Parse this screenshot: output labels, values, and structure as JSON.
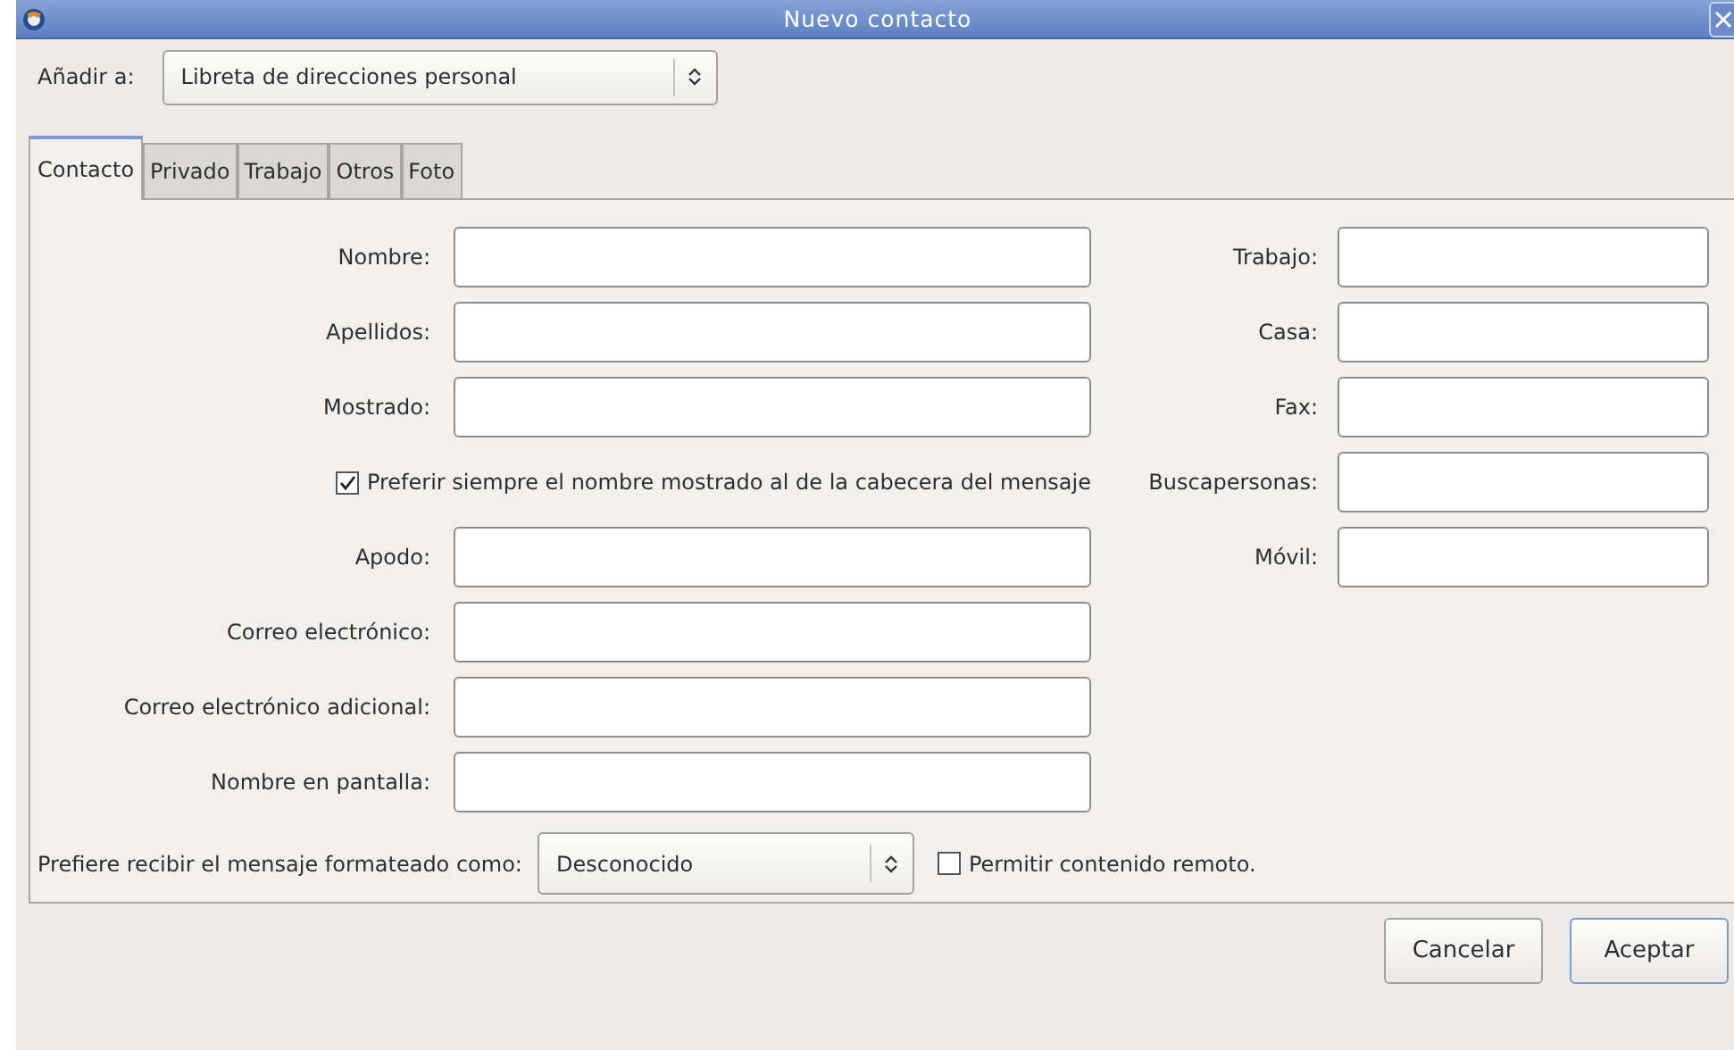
{
  "window": {
    "title": "Nuevo contacto"
  },
  "add_to": {
    "label": "Añadir a:",
    "value": "Libreta de direcciones personal"
  },
  "tabs": [
    {
      "label": "Contacto",
      "selected": true
    },
    {
      "label": "Privado",
      "selected": false
    },
    {
      "label": "Trabajo",
      "selected": false
    },
    {
      "label": "Otros",
      "selected": false
    },
    {
      "label": "Foto",
      "selected": false
    }
  ],
  "name_fields": [
    {
      "label": "Nombre:"
    },
    {
      "label": "Apellidos:"
    },
    {
      "label": "Mostrado:"
    }
  ],
  "prefer_display_name": {
    "label": "Preferir siempre el nombre mostrado al de la cabecera del mensaje",
    "checked": true
  },
  "other_fields": [
    {
      "label": "Apodo:"
    },
    {
      "label": "Correo electrónico:"
    },
    {
      "label": "Correo electrónico adicional:"
    },
    {
      "label": "Nombre en pantalla:"
    }
  ],
  "phone_fields": [
    {
      "label": "Trabajo:"
    },
    {
      "label": "Casa:"
    },
    {
      "label": "Fax:"
    },
    {
      "label": "Buscapersonas:"
    },
    {
      "label": "Móvil:"
    }
  ],
  "format": {
    "label": "Prefiere recibir el mensaje formateado como:",
    "value": "Desconocido"
  },
  "remote_content": {
    "label": "Permitir contenido remoto.",
    "checked": false
  },
  "buttons": [
    {
      "label": "Cancelar",
      "default": false
    },
    {
      "label": "Aceptar",
      "default": true
    }
  ]
}
